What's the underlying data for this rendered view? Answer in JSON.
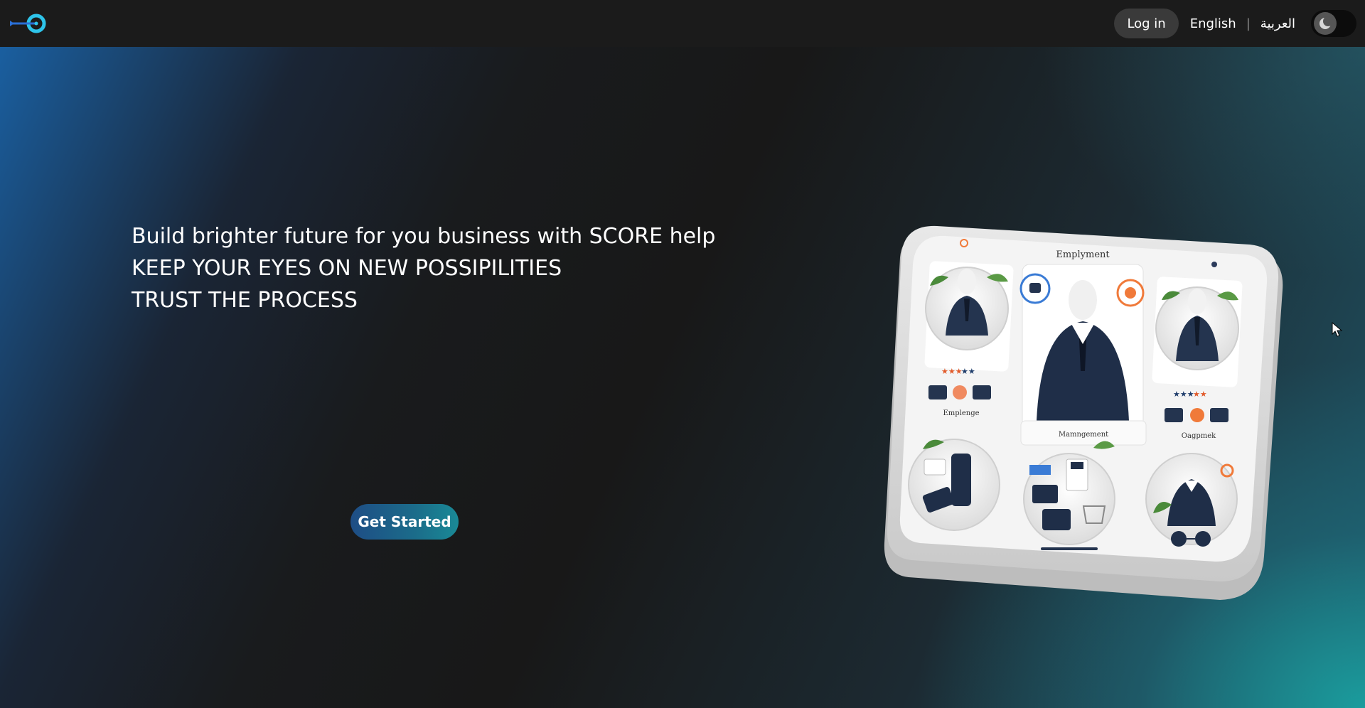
{
  "header": {
    "logo_icon": "target-arrow-logo-icon",
    "login_label": "Log in",
    "lang_english": "English",
    "lang_separator": "|",
    "lang_arabic": "العربية",
    "theme_icon": "moon-icon"
  },
  "hero": {
    "lines": [
      "Build brighter future for you business with SCORE help",
      "KEEP YOUR EYES ON NEW POSSIPILITIES",
      "TRUST THE PROCESS"
    ],
    "cta_label": "Get Started",
    "illustration": {
      "title": "Emplyment",
      "labels": [
        "Emplenge",
        "Mamngement",
        "Oagpmek"
      ]
    }
  },
  "colors": {
    "accent_cyan": "#2ec4ea",
    "accent_blue": "#1e4d85",
    "teal": "#1a8a96",
    "nav_bg": "#1b1b1b"
  }
}
